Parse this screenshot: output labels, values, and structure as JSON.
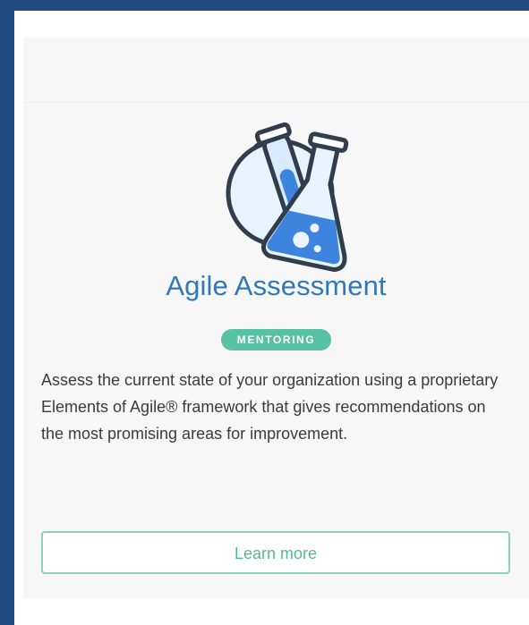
{
  "card": {
    "icon": "chemistry-flask-icon",
    "title": "Agile Assessment",
    "badge": "MENTORING",
    "description": "Assess the current state of your organization using a proprietary Elements of Agile® framework that gives recommendations on the most promising areas for improvement.",
    "button_label": "Learn more"
  },
  "colors": {
    "page_background": "#1f4b80",
    "card_background": "#f7f7f7",
    "title": "#2f79b9",
    "badge": "#57c2a3",
    "button_border": "#8dd1bc",
    "button_text": "#52b998",
    "icon_outline": "#2f3d4d",
    "icon_liquid": "#3c84dd",
    "icon_glass": "#e8f4ff"
  }
}
